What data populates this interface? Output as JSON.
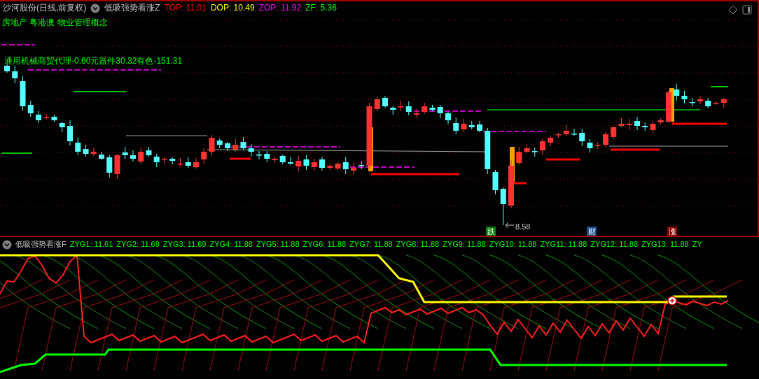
{
  "main_chart": {
    "stock": "沙河股份(日线,前复权)",
    "indicator": "低吸强势看涨Z",
    "readings": [
      {
        "text": "TOP: 11.01",
        "color": "#ff0000"
      },
      {
        "text": "DOP: 10.49",
        "color": "#ffff00"
      },
      {
        "text": "ZOP: 11.92",
        "color": "#ff00ff"
      },
      {
        "text": "ZF: 5.36",
        "color": "#00ff00"
      }
    ],
    "concepts": [
      "房地产 粤港澳 物业管理概念",
      "通用机械商贸代理-0.60元器件30.32有色-151.31"
    ],
    "low_marker": "8.58",
    "events": [
      {
        "label": "跌",
        "color": "#008000"
      },
      {
        "label": "财",
        "color": "#1f4e8c"
      },
      {
        "label": "涨",
        "color": "#8b0000"
      }
    ]
  },
  "indicator_panel": {
    "name": "低吸强势看涨F",
    "readings": [
      "ZYG1: 11.61",
      "ZYG2: 11.69",
      "ZYG3: 11.69",
      "ZYG4: 11.88",
      "ZYG5: 11.88",
      "ZYG6: 11.88",
      "ZYG7: 11.88",
      "ZYG8: 11.88",
      "ZYG9: 11.88",
      "ZYG10: 11.88",
      "ZYG11: 11.88",
      "ZYG12: 11.88",
      "ZYG13: 11.88",
      "ZY"
    ]
  }
}
